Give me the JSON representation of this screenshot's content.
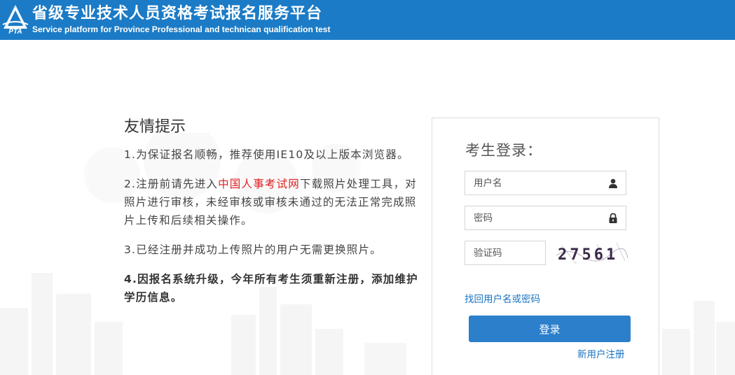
{
  "header": {
    "title": "省级专业技术人员资格考试报名服务平台",
    "subtitle": "Service platform for Province Professional and technican qualification test",
    "logo_text": "PTA",
    "bg_color": "#1b7bc6"
  },
  "tips": {
    "title": "友情提示",
    "item1": "1.为保证报名顺畅，推荐使用IE10及以上版本浏览器。",
    "item2_before": "2.注册前请先进入",
    "item2_link": "中国人事考试网",
    "item2_after": "下载照片处理工具，对照片进行审核，未经审核或审核未通过的无法正常完成照片上传和后续相关操作。",
    "item3": "3.已经注册并成功上传照片的用户无需更换照片。",
    "item4": "4.因报名系统升级，今年所有考生须重新注册，添加维护学历信息。"
  },
  "login": {
    "title": "考生登录：",
    "username_placeholder": "用户名",
    "password_placeholder": "密码",
    "captcha_placeholder": "验证码",
    "captcha_text": "27561",
    "forgot_link": "找回用户名或密码",
    "submit_label": "登录",
    "register_link": "新用户注册",
    "user_icon": "user-icon",
    "lock_icon": "lock-icon",
    "accent_color": "#2b7fcb",
    "link_color": "#1a73c2"
  }
}
